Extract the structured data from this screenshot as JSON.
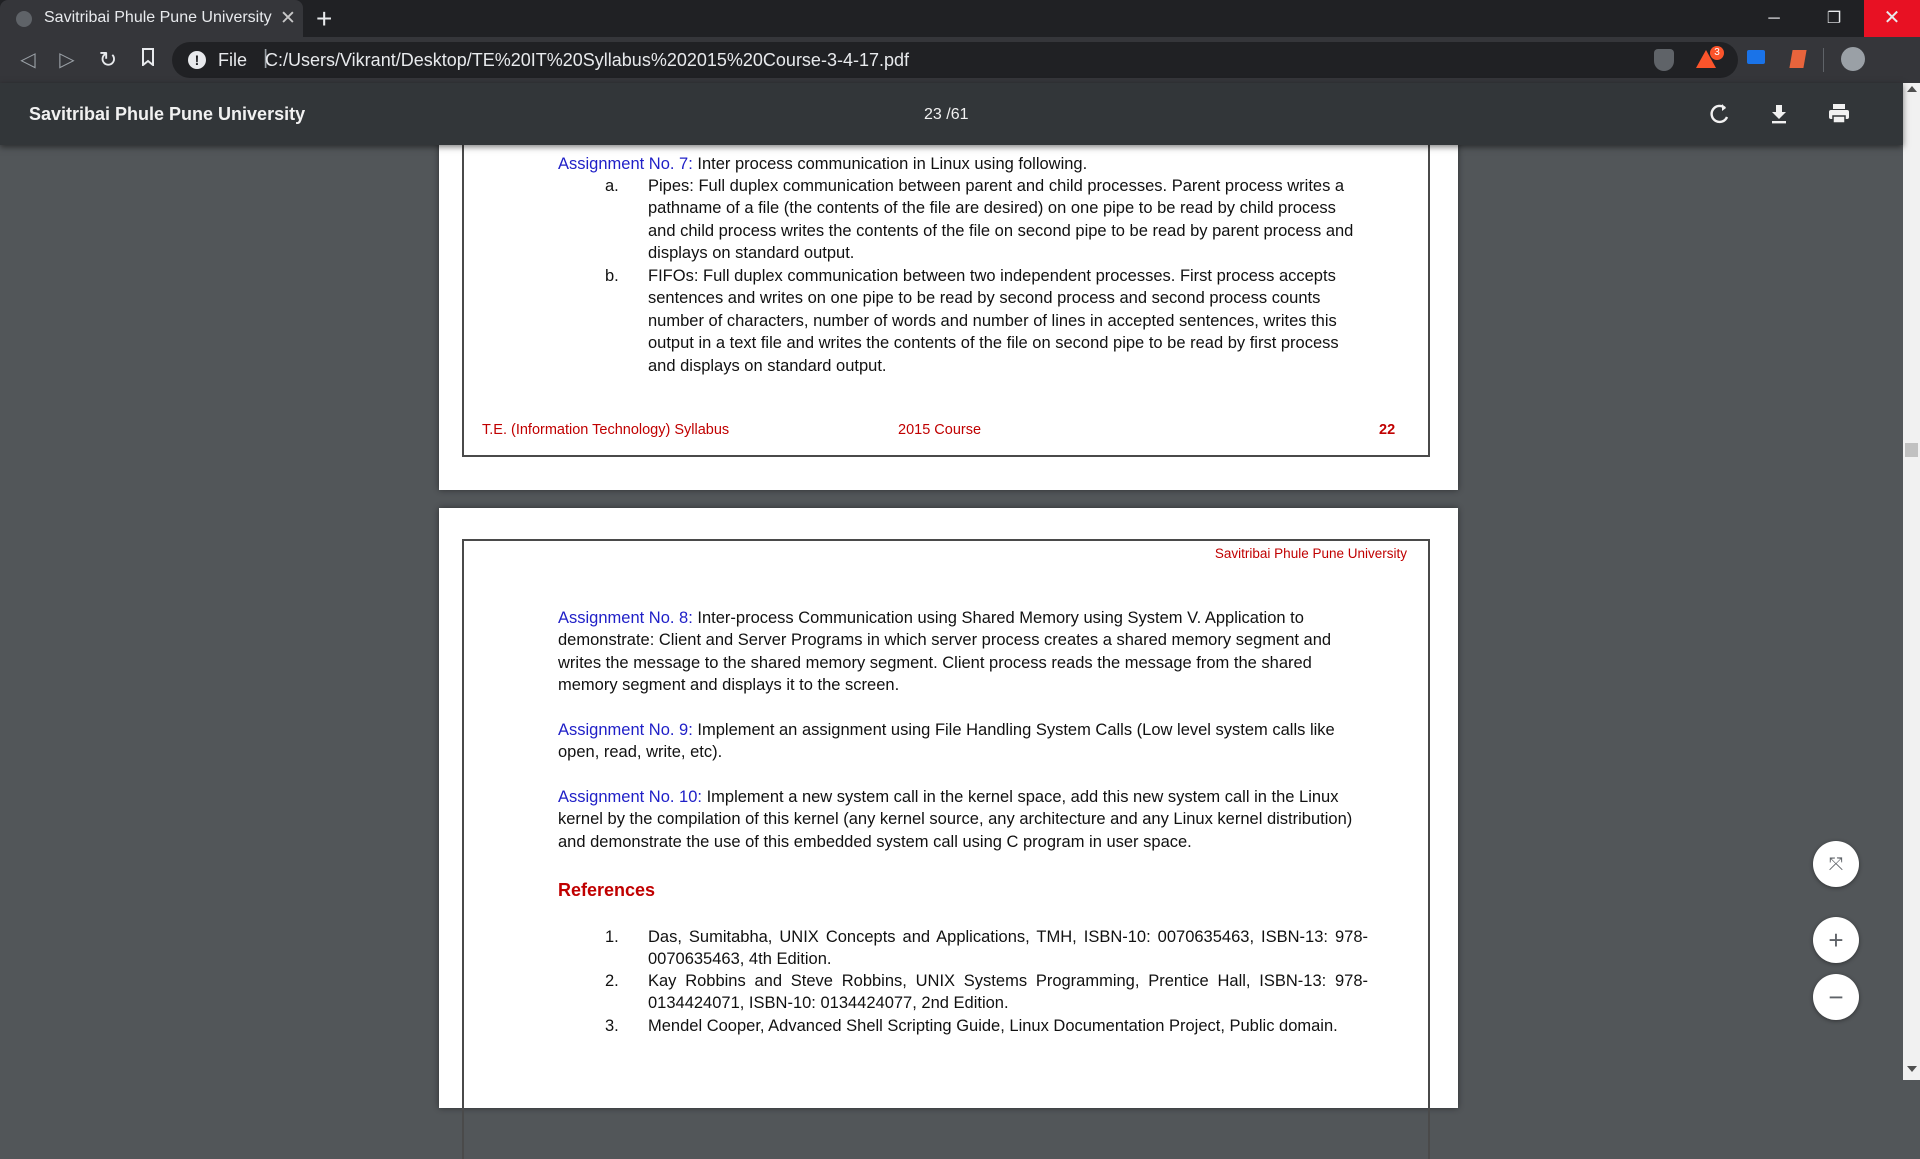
{
  "tab": {
    "title": "Savitribai Phule Pune University",
    "close": "✕",
    "new_tab": "+"
  },
  "window": {
    "minimize": "─",
    "maximize": "❐",
    "close": "✕"
  },
  "toolbar": {
    "back": "◁",
    "forward": "▷",
    "reload": "↻",
    "bookmark": "🔖",
    "info": "!",
    "scheme": "File",
    "separator": "|",
    "url": "C:/Users/Vikrant/Desktop/TE%20IT%20Syllabus%202015%20Course-3-4-17.pdf",
    "rewards_badge": "3",
    "menu": "⋮"
  },
  "pdf_toolbar": {
    "title": "Savitribai Phule Pune University",
    "page_indicator": "23 /61"
  },
  "page1": {
    "assignment7_label": "Assignment No. 7:",
    "assignment7_text": " Inter process communication in Linux using following.",
    "items": [
      {
        "marker": "a.",
        "text": "Pipes: Full duplex communication between parent and child processes. Parent process writes a pathname of a file (the contents of the file are desired) on one pipe to be read by child process and child process writes the contents of the file on second pipe to be read by parent process and displays on standard output."
      },
      {
        "marker": "b.",
        "text": "FIFOs: Full duplex communication between two independent processes. First process accepts sentences and writes on one pipe to be read by second process and second process counts number of characters, number of words and number of lines in accepted sentences, writes this output in a text file and writes the contents of the file on second pipe to be read by first process and displays on standard output."
      }
    ],
    "footer_left": "T.E. (Information Technology) Syllabus",
    "footer_center": "2015 Course",
    "footer_right": "22"
  },
  "page2": {
    "header": "Savitribai Phule Pune University",
    "assignment8_label": "Assignment No. 8:",
    "assignment8_text": " Inter-process Communication using Shared Memory using System V. Application to demonstrate: Client and Server Programs in which server process creates a shared memory segment and writes the message to the shared memory segment. Client process reads the message from the shared memory segment and displays it to the screen.",
    "assignment9_label": "Assignment No. 9:",
    "assignment9_text": " Implement an assignment using File Handling System Calls (Low level system calls like open, read, write, etc).",
    "assignment10_label": "Assignment No. 10:",
    "assignment10_text": " Implement a new system call in the kernel space, add this new system call in the Linux kernel by the compilation of this kernel (any kernel source, any architecture and any Linux kernel distribution) and demonstrate the use of this embedded system call using C program in user space.",
    "references_heading": "References",
    "references": [
      {
        "marker": "1.",
        "text": "Das, Sumitabha, UNIX Concepts and Applications, TMH, ISBN-10: 0070635463, ISBN-13: 978-0070635463, 4th Edition."
      },
      {
        "marker": "2.",
        "text": "Kay Robbins and Steve Robbins, UNIX Systems Programming, Prentice Hall, ISBN-13: 978-0134424071, ISBN-10: 0134424077, 2nd Edition."
      },
      {
        "marker": "3.",
        "text": "Mendel Cooper, Advanced Shell Scripting Guide, Linux Documentation Project, Public domain."
      }
    ]
  },
  "fabs": {
    "fit": "⤧",
    "zoom_in": "+",
    "zoom_out": "−"
  }
}
